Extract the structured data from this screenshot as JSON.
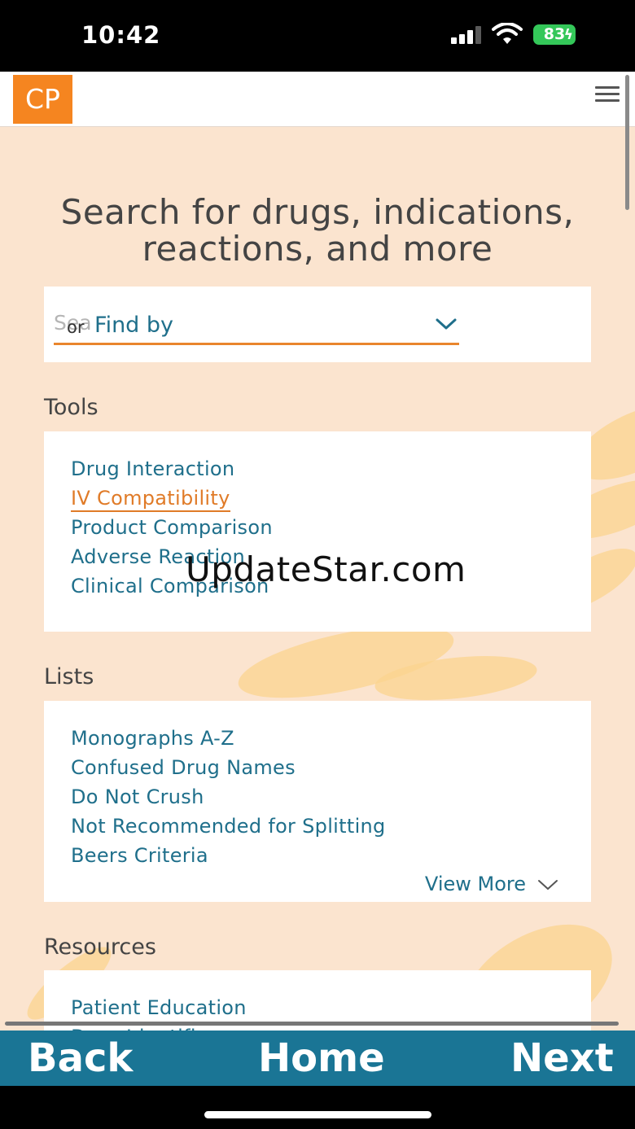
{
  "status_bar": {
    "time": "10:42",
    "battery": "83"
  },
  "app": {
    "logo": "CP",
    "accent_color": "#f58520",
    "link_color": "#1f6f8b",
    "nav_bar_color": "#1a7595"
  },
  "hero": {
    "line1": "Search for drugs, indications,",
    "line2": "reactions, and more"
  },
  "search": {
    "placeholder": "Sea",
    "or_label": "or",
    "find_by_label": "Find by"
  },
  "tools": {
    "title": "Tools",
    "items": [
      {
        "label": "Drug Interaction"
      },
      {
        "label": "IV Compatibility"
      },
      {
        "label": "Product Comparison"
      },
      {
        "label": "Adverse Reaction"
      },
      {
        "label": "Clinical Comparison"
      }
    ]
  },
  "lists": {
    "title": "Lists",
    "items": [
      {
        "label": "Monographs A-Z"
      },
      {
        "label": "Confused Drug Names"
      },
      {
        "label": "Do Not Crush"
      },
      {
        "label": "Not Recommended for Splitting"
      },
      {
        "label": "Beers Criteria"
      }
    ],
    "view_more": "View More"
  },
  "resources": {
    "title": "Resources",
    "items": [
      {
        "label": "Patient Education"
      },
      {
        "label": "Drug Identifier"
      }
    ]
  },
  "watermark": "UpdateStar.com",
  "bottom_nav": {
    "back": "Back",
    "home": "Home",
    "next": "Next"
  }
}
